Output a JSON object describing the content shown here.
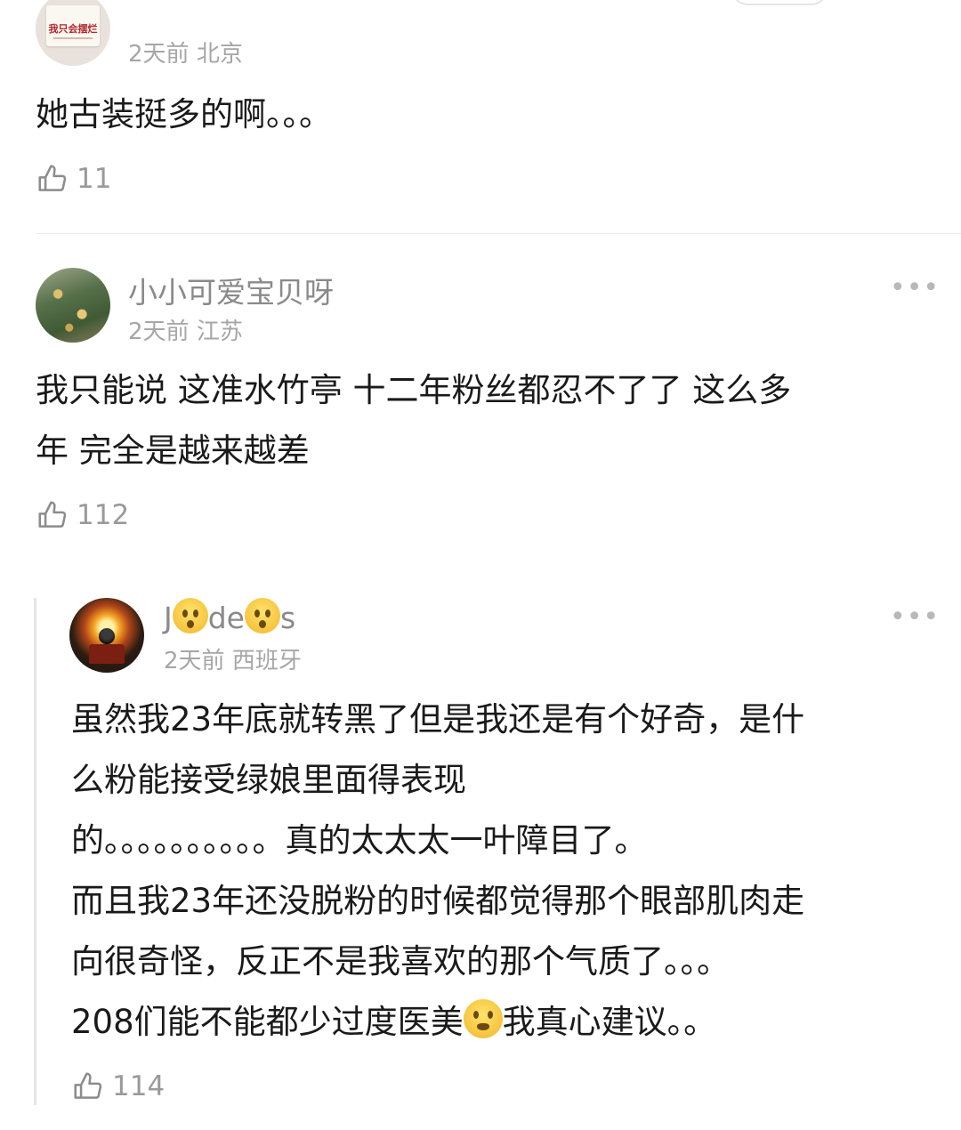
{
  "comments": [
    {
      "name": "",
      "avatar_text": "我只会摆烂",
      "time": "2天前",
      "location": "北京",
      "content_lines": [
        "她古装挺多的啊。。。"
      ],
      "likes": "11"
    },
    {
      "name": "小小可爱宝贝呀",
      "time": "2天前",
      "location": "江苏",
      "content_lines": [
        "我只能说 这准水竹亭 十二年粉丝都忍不了了 这么多",
        "年 完全是越来越差"
      ],
      "likes": "112",
      "more": "•••"
    }
  ],
  "reply": {
    "name_part1": "J",
    "name_part2": "de",
    "name_part3": "s",
    "time": "2天前",
    "location": "西班牙",
    "content_lines": [
      "虽然我23年底就转黑了但是我还是有个好奇，是什",
      "么粉能接受绿娘里面得表现",
      "的。。。。。。。。。。真的太太太一叶障目了。",
      "而且我23年还没脱粉的时候都觉得那个眼部肌肉走",
      "向很奇怪，反正不是我喜欢的那个气质了。。。"
    ],
    "last_line_before_emoji": "208们能不能都少过度医美",
    "last_line_after_emoji": "我真心建议。。",
    "likes": "114",
    "more": "•••",
    "emoji_icons": [
      "hushed-face-icon",
      "hushed-face-icon",
      "sneezing-face-icon"
    ]
  },
  "colors": {
    "text": "#1a1a1a",
    "meta": "#a6a6a6",
    "name": "#8a8a8a"
  }
}
